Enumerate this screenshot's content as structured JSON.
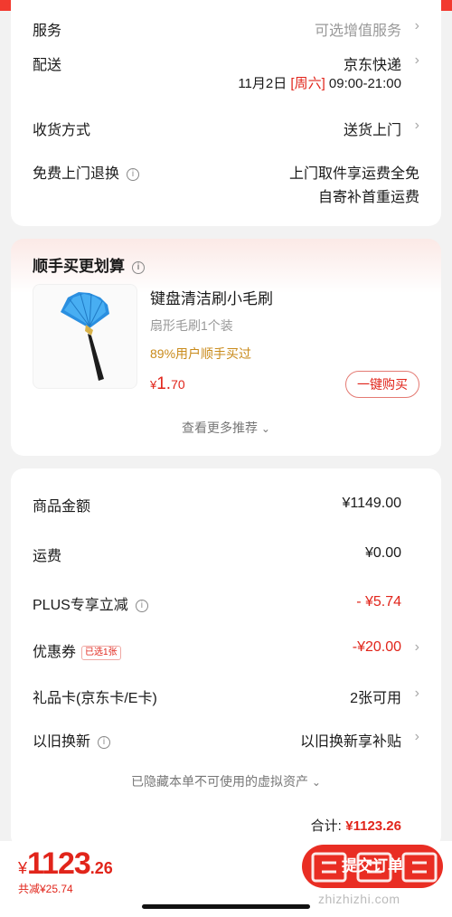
{
  "colors": {
    "accent": "#e1251b",
    "gold": "#c98a1a",
    "background": "#f2f2f2"
  },
  "delivery": {
    "service_label": "服务",
    "service_value": "可选增值服务",
    "shipping_label": "配送",
    "shipping_value": "京东快递",
    "date": "11月2日",
    "weekday": "[周六]",
    "time": "09:00-21:00",
    "receive_label": "收货方式",
    "receive_value": "送货上门",
    "return_label": "免费上门退换",
    "return_value_line1": "上门取件享运费全免",
    "return_value_line2": "自寄补首重运费"
  },
  "upsell": {
    "title": "顺手买更划算",
    "product_name": "键盘清洁刷小毛刷",
    "product_spec": "扇形毛刷1个装",
    "product_stat": "89%用户顺手买过",
    "price_symbol": "¥",
    "price_int": "1.",
    "price_dec": "70",
    "buy_label": "一键购买",
    "more_label": "查看更多推荐",
    "image_icon": "fan-brush-product-image"
  },
  "summary": {
    "goods_label": "商品金额",
    "goods_value": "¥1149.00",
    "freight_label": "运费",
    "freight_value": "¥0.00",
    "plus_label": "PLUS专享立减",
    "plus_value": "- ¥5.74",
    "coupon_label": "优惠券",
    "coupon_tag": "已选1张",
    "coupon_value": "-¥20.00",
    "giftcard_label": "礼品卡(京东卡/E卡)",
    "giftcard_value": "2张可用",
    "tradein_label": "以旧换新",
    "tradein_value": "以旧换新享补贴",
    "hidden_note": "已隐藏本单不可使用的虚拟资产",
    "total_label": "合计:",
    "total_value": "¥1123.26"
  },
  "bottom": {
    "yen": "¥",
    "total_int": "1123",
    "total_dec": ".26",
    "saved": "共减¥25.74",
    "submit_label": "提交订单",
    "watermark_url": "zhizhizhi.com"
  }
}
